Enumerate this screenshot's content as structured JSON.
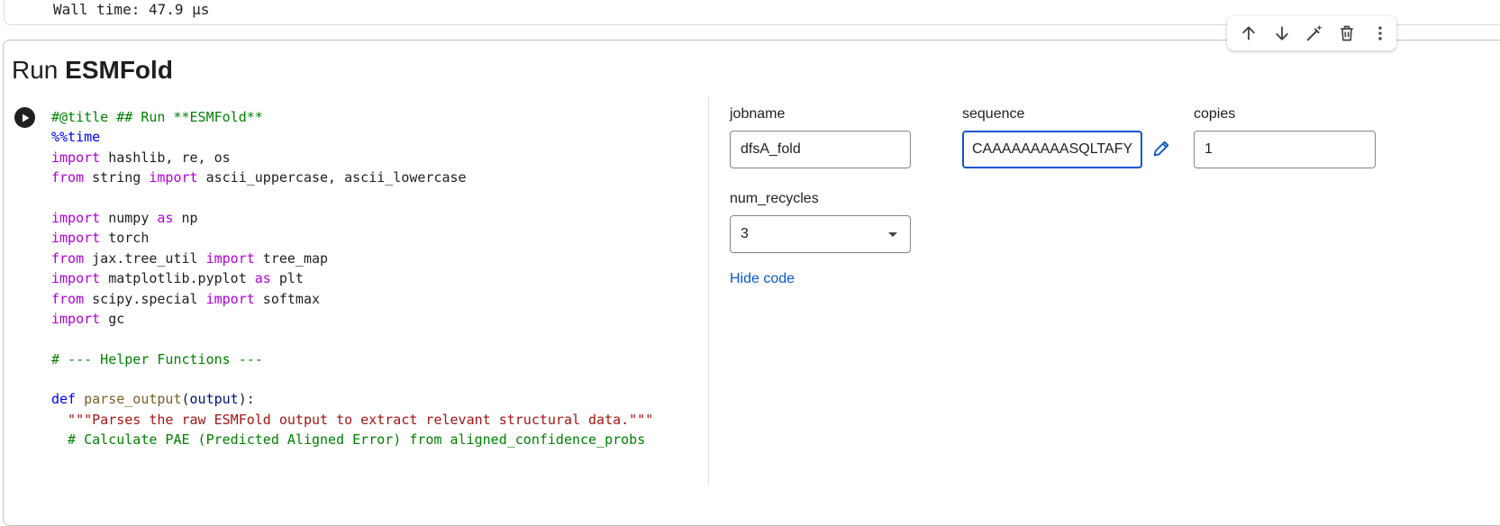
{
  "previous_cell": {
    "output_text": "Wall time: 47.9 µs"
  },
  "cell": {
    "title_prefix": "Run ",
    "title_bold": "ESMFold",
    "toolbar": {
      "move_up_icon": "arrow-up-icon",
      "move_down_icon": "arrow-down-icon",
      "edit_icon": "magic-edit-icon",
      "delete_icon": "trash-icon",
      "more_icon": "more-vert-icon"
    }
  },
  "code_lines": [
    [
      {
        "t": "#@title ## Run **ESMFold**",
        "c": "comment"
      }
    ],
    [
      {
        "t": "%%time",
        "c": "magic"
      }
    ],
    [
      {
        "t": "import",
        "c": "kw"
      },
      {
        "t": " hashlib, re, os",
        "c": ""
      }
    ],
    [
      {
        "t": "from",
        "c": "kw"
      },
      {
        "t": " string ",
        "c": ""
      },
      {
        "t": "import",
        "c": "kw"
      },
      {
        "t": " ascii_uppercase, ascii_lowercase",
        "c": ""
      }
    ],
    [
      {
        "t": "",
        "c": ""
      }
    ],
    [
      {
        "t": "import",
        "c": "kw"
      },
      {
        "t": " numpy ",
        "c": ""
      },
      {
        "t": "as",
        "c": "kw"
      },
      {
        "t": " np",
        "c": ""
      }
    ],
    [
      {
        "t": "import",
        "c": "kw"
      },
      {
        "t": " torch",
        "c": ""
      }
    ],
    [
      {
        "t": "from",
        "c": "kw"
      },
      {
        "t": " jax.tree_util ",
        "c": ""
      },
      {
        "t": "import",
        "c": "kw"
      },
      {
        "t": " tree_map",
        "c": ""
      }
    ],
    [
      {
        "t": "import",
        "c": "kw"
      },
      {
        "t": " matplotlib.pyplot ",
        "c": ""
      },
      {
        "t": "as",
        "c": "kw"
      },
      {
        "t": " plt",
        "c": ""
      }
    ],
    [
      {
        "t": "from",
        "c": "kw"
      },
      {
        "t": " scipy.special ",
        "c": ""
      },
      {
        "t": "import",
        "c": "kw"
      },
      {
        "t": " softmax",
        "c": ""
      }
    ],
    [
      {
        "t": "import",
        "c": "kw"
      },
      {
        "t": " gc",
        "c": ""
      }
    ],
    [
      {
        "t": "",
        "c": ""
      }
    ],
    [
      {
        "t": "# --- Helper Functions ---",
        "c": "comment"
      }
    ],
    [
      {
        "t": "",
        "c": ""
      }
    ],
    [
      {
        "t": "def",
        "c": "def"
      },
      {
        "t": " ",
        "c": ""
      },
      {
        "t": "parse_output",
        "c": "fn"
      },
      {
        "t": "(",
        "c": ""
      },
      {
        "t": "output",
        "c": "param"
      },
      {
        "t": "):",
        "c": ""
      }
    ],
    [
      {
        "t": "  \"\"\"Parses the raw ESMFold output to extract relevant structural data.\"\"\"",
        "c": "str"
      }
    ],
    [
      {
        "t": "  # Calculate PAE (Predicted Aligned Error) from aligned_confidence_probs",
        "c": "comment"
      }
    ]
  ],
  "form": {
    "jobname": {
      "label": "jobname",
      "value": "dfsA_fold"
    },
    "sequence": {
      "label": "sequence",
      "value": "CAAAAAAAAASQLTAFY"
    },
    "copies": {
      "label": "copies",
      "value": "1"
    },
    "num_recycles": {
      "label": "num_recycles",
      "value": "3"
    },
    "hide_code": "Hide code",
    "sequence_edit_icon": "pencil-icon"
  },
  "colors": {
    "focus_blue": "#0b57d0",
    "comment": "#008000",
    "keyword": "#af00db",
    "magic": "#0000ff",
    "string": "#a31515"
  }
}
